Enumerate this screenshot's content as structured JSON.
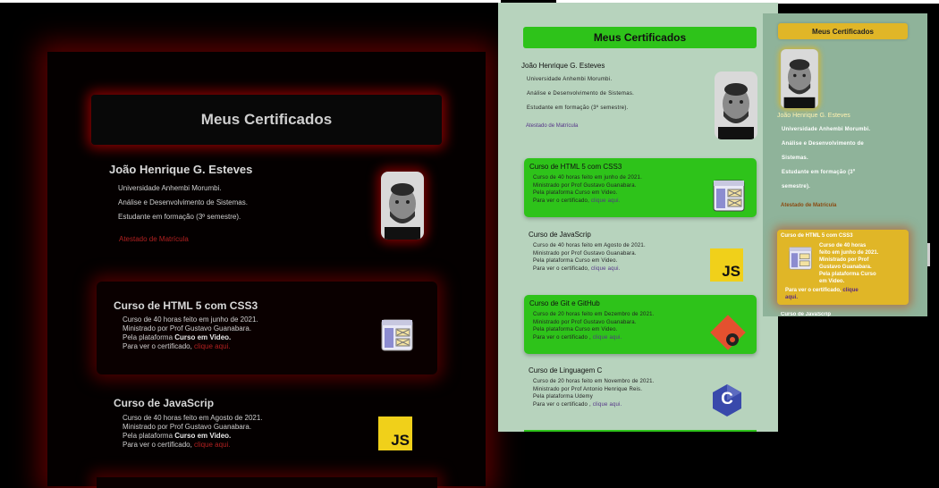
{
  "title": "Meus Certificados",
  "profile": {
    "name": "João Henrique G. Esteves",
    "university": "Universidade Anhembi Morumbi.",
    "course": "Análise e Desenvolvimento de Sistemas.",
    "status": "Estudante em formação (3º semestre).",
    "atestado": "Atestado de Matrícula"
  },
  "dark_panel": {
    "certificates": [
      {
        "title": "Curso de HTML 5 com CSS3",
        "line1": "Curso de 40 horas feito em junho de 2021.",
        "line2": "Ministrado por Prof Gustavo Guanabara.",
        "line3_prefix": "Pela plataforma ",
        "platform": "Curso em Video.",
        "line4_prefix": "Para ver o certificado, ",
        "link": "clique aqui."
      },
      {
        "title": "Curso de JavaScrip",
        "line1": "Curso de 40 horas feito em Agosto de 2021.",
        "line2": "Ministrado por Prof Gustavo Guanabara.",
        "line3_prefix": "Pela plataforma ",
        "platform": "Curso em Video.",
        "line4_prefix": "Para ver o certificado, ",
        "link": "clique aqui."
      }
    ]
  },
  "green_panel": {
    "certificates": [
      {
        "title": "Curso de HTML 5 com CSS3",
        "line1": "Curso de 40 horas feito em junho de 2021.",
        "line2": "Ministrado por Prof Gustavo Guanabara.",
        "line3": "Pela plataforma Curso em Video.",
        "line4_prefix": "Para ver o certificado, ",
        "link": "clique aqui."
      },
      {
        "title": "Curso de JavaScrip",
        "line1": "Curso de 40 horas feito em Agosto de 2021.",
        "line2": "Ministrado por Prof Gustavo Guanabara.",
        "line3": "Pela plataforma Curso em Video.",
        "line4_prefix": "Para ver o certificado, ",
        "link": "clique aqui."
      },
      {
        "title": "Curso de Git e GitHub",
        "line1": "Curso de 20 horas feito em Dezembro de 2021.",
        "line2": "Ministrado por Prof Gustavo Guanabara.",
        "line3": "Pela plataforma Curso em Video.",
        "line4_prefix": "Para ver o certificado , ",
        "link": "clique aqui."
      },
      {
        "title": "Curso de Linguagem C",
        "line1": "Curso de 20 horas feito em Novembro de 2021.",
        "line2": "Ministrado por Prof Antonio Henrique Reis.",
        "line3": "Pela plataforma Udemy",
        "line4_prefix": "Para ver o certificado , ",
        "link": "clique aqui."
      }
    ]
  },
  "yellow_panel": {
    "university": "Universidade Anhembi Morumbi.",
    "course_a": "Análise e Desenvolvimento de",
    "course_b": "Sistemas.",
    "status_a": "Estudante em formação (3º",
    "status_b": "semestre).",
    "certificate": {
      "title": "Curso de HTML 5 com CSS3",
      "line1": "Curso de 40 horas",
      "line2": "feito em junho de 2021.",
      "line3": "Ministrado por Prof",
      "line4": "Gustavo Guanabara.",
      "line5": "Pela plataforma Curso",
      "line6": "em Video.",
      "line7_prefix": "Para ver o certificado, ",
      "link_a": "clique",
      "link_b": "aqui."
    },
    "next_title": "Curso de JavaScrip"
  },
  "icons": {
    "js_label": "JS",
    "c_label": "C"
  },
  "colors": {
    "dark_glow": "#b00000",
    "green_accent": "#2ec31a",
    "yellow_accent": "#e0b627",
    "link_red": "#b02020",
    "link_purple": "#553388"
  }
}
